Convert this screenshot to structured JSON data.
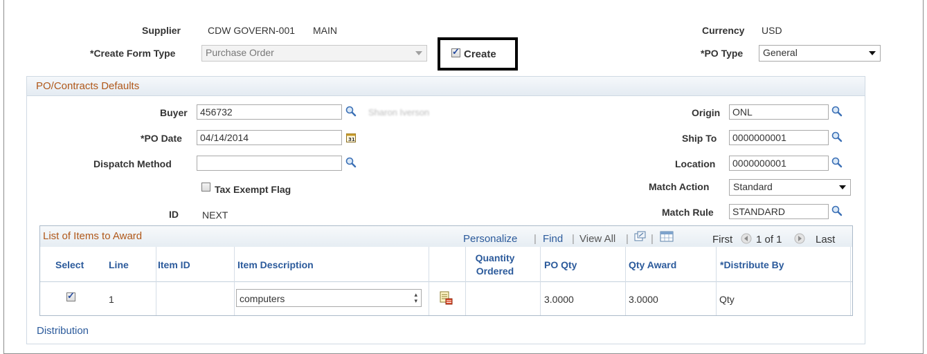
{
  "header": {
    "supplier_label": "Supplier",
    "supplier_value": "CDW GOVERN-001",
    "supplier_loc": "MAIN",
    "create_form_type_label": "*Create Form Type",
    "create_form_type_value": "Purchase Order",
    "create_label": "Create",
    "create_checked": true,
    "currency_label": "Currency",
    "currency_value": "USD",
    "po_type_label": "*PO Type",
    "po_type_value": "General"
  },
  "defaults": {
    "section_title": "PO/Contracts Defaults",
    "buyer_label": "Buyer",
    "buyer_value": "456732",
    "buyer_name": "Sharon Iverson",
    "po_date_label": "*PO Date",
    "po_date_value": "04/14/2014",
    "dispatch_label": "Dispatch Method",
    "dispatch_value": "",
    "tax_exempt_label": "Tax Exempt Flag",
    "tax_exempt_checked": false,
    "id_label": "ID",
    "id_value": "NEXT",
    "origin_label": "Origin",
    "origin_value": "ONL",
    "ship_to_label": "Ship To",
    "ship_to_value": "0000000001",
    "location_label": "Location",
    "location_value": "0000000001",
    "match_action_label": "Match Action",
    "match_action_value": "Standard",
    "match_rule_label": "Match Rule",
    "match_rule_value": "STANDARD"
  },
  "grid": {
    "title": "List of Items to Award",
    "personalize": "Personalize",
    "find": "Find",
    "view_all": "View All",
    "first": "First",
    "page_info": "1 of 1",
    "last": "Last",
    "columns": {
      "select": "Select",
      "line": "Line",
      "item_id": "Item ID",
      "item_desc": "Item Description",
      "qty_ordered_1": "Quantity",
      "qty_ordered_2": "Ordered",
      "po_qty": "PO Qty",
      "qty_award": "Qty Award",
      "distribute_by": "*Distribute By"
    },
    "rows": [
      {
        "selected": true,
        "line": "1",
        "item_id": "",
        "item_desc": "computers",
        "qty_ordered": "",
        "po_qty": "3.0000",
        "qty_award": "3.0000",
        "distribute_by": "Qty"
      }
    ]
  },
  "footer": {
    "distribution_link": "Distribution"
  },
  "colors": {
    "accent_orange": "#b0581a",
    "link_blue": "#2b5a9b"
  }
}
